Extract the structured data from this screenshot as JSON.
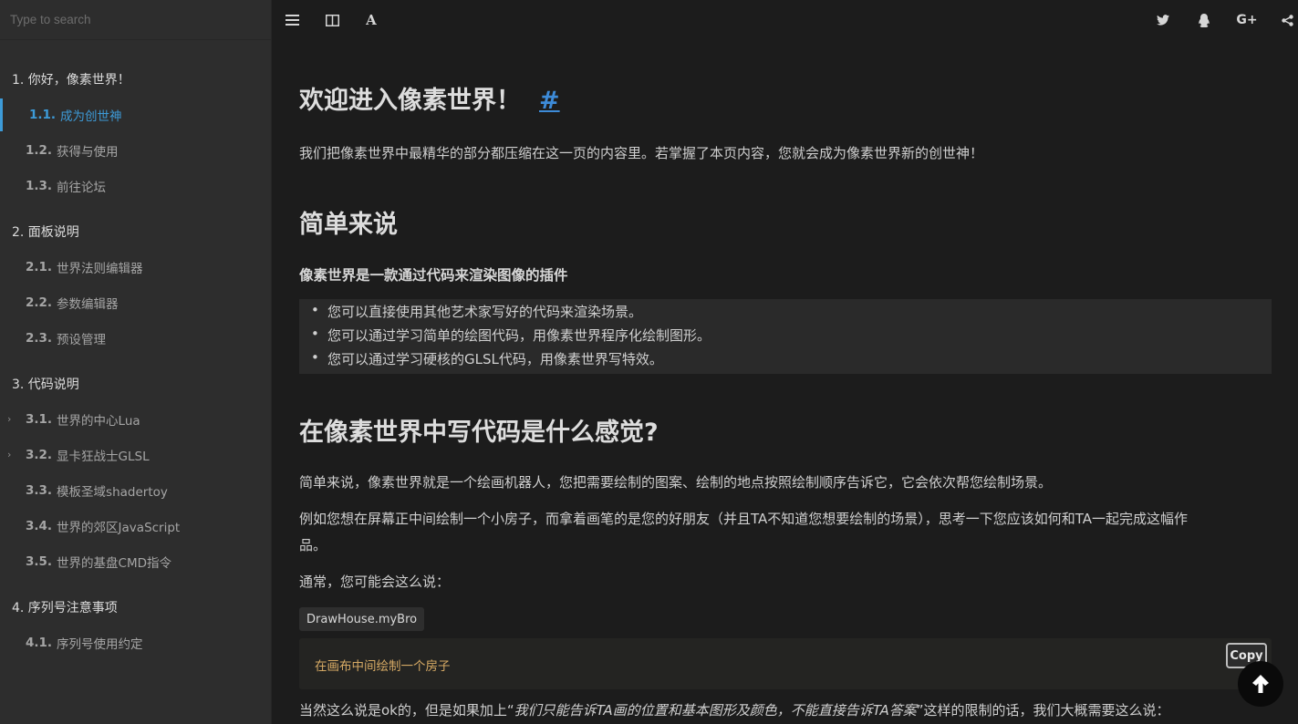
{
  "search": {
    "placeholder": "Type to search"
  },
  "toc": [
    {
      "type": "chapter",
      "label": "1. 你好，像素世界！"
    },
    {
      "type": "section",
      "num": "1.1.",
      "label": "成为创世神",
      "active": true
    },
    {
      "type": "section",
      "num": "1.2.",
      "label": "获得与使用"
    },
    {
      "type": "section",
      "num": "1.3.",
      "label": "前往论坛"
    },
    {
      "type": "chapter",
      "label": "2. 面板说明"
    },
    {
      "type": "section",
      "num": "2.1.",
      "label": "世界法则编辑器"
    },
    {
      "type": "section",
      "num": "2.2.",
      "label": "参数编辑器"
    },
    {
      "type": "section",
      "num": "2.3.",
      "label": "预设管理"
    },
    {
      "type": "chapter",
      "label": "3. 代码说明"
    },
    {
      "type": "section",
      "num": "3.1.",
      "label": "世界的中心Lua",
      "expandable": true
    },
    {
      "type": "section",
      "num": "3.2.",
      "label": "显卡狂战士GLSL",
      "expandable": true
    },
    {
      "type": "section",
      "num": "3.3.",
      "label": "模板圣域shadertoy"
    },
    {
      "type": "section",
      "num": "3.4.",
      "label": "世界的郊区JavaScript"
    },
    {
      "type": "section",
      "num": "3.5.",
      "label": "世界的基盘CMD指令"
    },
    {
      "type": "chapter",
      "label": "4. 序列号注意事项"
    },
    {
      "type": "section",
      "num": "4.1.",
      "label": "序列号使用约定"
    }
  ],
  "toolbar": {
    "icons": [
      "menu-icon",
      "book-icon",
      "font-icon",
      "twitter-icon",
      "qq-icon",
      "google-plus-icon",
      "share-icon"
    ]
  },
  "content": {
    "title": "欢迎进入像素世界！",
    "anchor": "#",
    "intro": "我们把像素世界中最精华的部分都压缩在这一页的内容里。若掌握了本页内容，您就会成为像素世界新的创世神！",
    "h2_simple": "简单来说",
    "h4_plugin": "像素世界是一款通过代码来渲染图像的插件",
    "list": [
      "您可以直接使用其他艺术家写好的代码来渲染场景。",
      "您可以通过学习简单的绘图代码，用像素世界程序化绘制图形。",
      "您可以通过学习硬核的GLSL代码，用像素世界写特效。"
    ],
    "h2_feel": "在像素世界中写代码是什么感觉?",
    "p1": "简单来说，像素世界就是一个绘画机器人，您把需要绘制的图案、绘制的地点按照绘制顺序告诉它，它会依次帮您绘制场景。",
    "p2_line1": "例如您想在屏幕正中间绘制一个小房子，而拿着画笔的是您的好朋友（并且TA不知道您想要绘制的场景），思考一下您应该如何和TA一起完成这幅作",
    "p2_line2": "品。",
    "p3": "通常，您可能会这么说：",
    "inline_code": "DrawHouse.myBro",
    "code_text": "在画布中间绘制一个房子",
    "copy_label": "Copy",
    "p4_pre": "当然这么说是ok的，但是如果加上“",
    "p4_italic": "我们只能告诉TA画的位置和基本图形及颜色，不能直接告诉TA答案",
    "p4_post": "”这样的限制的话，我们大概需要这么说："
  }
}
